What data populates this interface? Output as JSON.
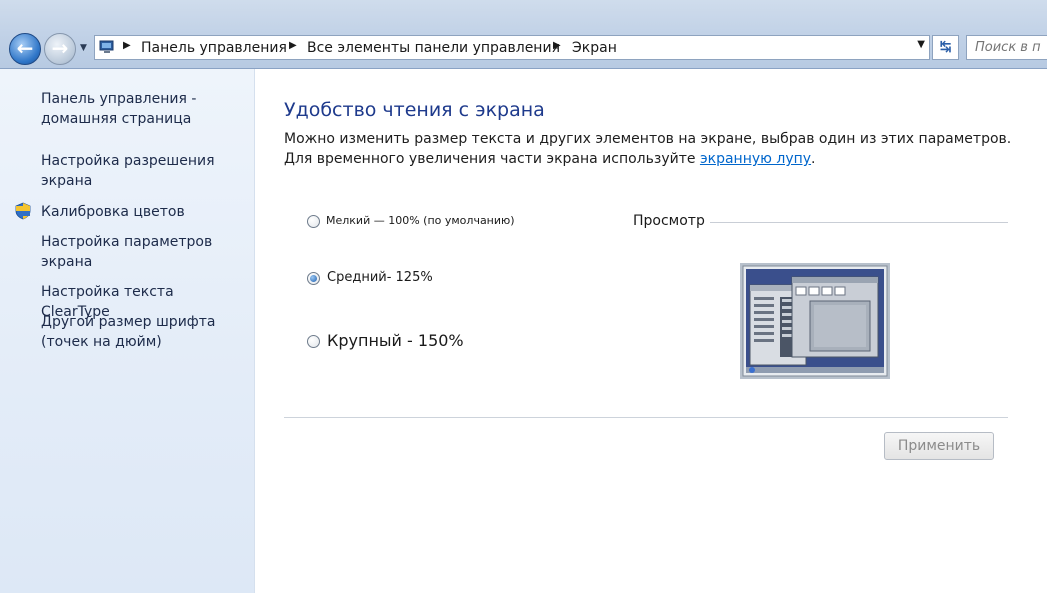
{
  "address": {
    "crumbs": [
      "Панель управления",
      "Все элементы панели управления",
      "Экран"
    ],
    "search_placeholder": "Поиск в п"
  },
  "sidebar": {
    "items": [
      {
        "label": "Панель управления - домашняя страница"
      },
      {
        "label": "Настройка разрешения экрана"
      },
      {
        "label": "Калибровка цветов"
      },
      {
        "label": "Настройка параметров экрана"
      },
      {
        "label": "Настройка текста ClearType"
      },
      {
        "label": "Другой размер шрифта (точек на дюйм)"
      }
    ]
  },
  "main": {
    "heading": "Удобство чтения с экрана",
    "description_prefix": "Можно изменить размер текста и других элементов на экране, выбрав один из этих параметров. Для временного увеличения части экрана используйте ",
    "magnifier_link": "экранную лупу",
    "description_suffix": ".",
    "options": [
      {
        "label": "Мелкий — 100% (по умолчанию)",
        "selected": false
      },
      {
        "label": "Средний- 125%",
        "selected": true
      },
      {
        "label": "Крупный - 150%",
        "selected": false
      }
    ],
    "preview_label": "Просмотр",
    "apply_label": "Применить"
  },
  "colors": {
    "heading": "#1e3a8c",
    "link": "#0066cc",
    "sidebar_bg": "#e3ecf8"
  }
}
